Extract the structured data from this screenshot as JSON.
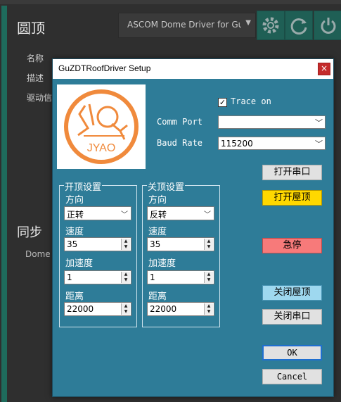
{
  "background": {
    "title": "圆顶",
    "driver_combo": "ASCOM Dome Driver for GuZDT",
    "labels": [
      "名称",
      "描述",
      "驱动信"
    ],
    "section": "同步",
    "sub_label": "Dome v"
  },
  "dialog": {
    "title": "GuZDTRoofDriver Setup",
    "close_label": "×",
    "logo_text": "JYAO",
    "trace_label": "Trace on",
    "trace_checked": "✓",
    "comm_port_label": "Comm Port",
    "comm_port_value": "",
    "baud_rate_label": "Baud Rate",
    "baud_rate_value": "115200",
    "open_group": {
      "title": "开顶设置",
      "direction_label": "方向",
      "direction_value": "正转",
      "speed_label": "速度",
      "speed_value": "35",
      "accel_label": "加速度",
      "accel_value": "1",
      "distance_label": "距离",
      "distance_value": "22000"
    },
    "close_group": {
      "title": "关顶设置",
      "direction_label": "方向",
      "direction_value": "反转",
      "speed_label": "速度",
      "speed_value": "35",
      "accel_label": "加速度",
      "accel_value": "1",
      "distance_label": "距离",
      "distance_value": "22000"
    },
    "buttons": {
      "open_port": "打开串口",
      "open_roof": "打开屋顶",
      "emergency_stop": "急停",
      "close_roof": "关闭屋顶",
      "close_port": "关闭串口",
      "ok": "OK",
      "cancel": "Cancel"
    }
  },
  "colors": {
    "dialog_bg": "#2e7c98",
    "open_roof": "#ffd800",
    "emergency_stop": "#f77a7a",
    "close_roof": "#9ed8ef",
    "logo_orange": "#f08a3c"
  }
}
